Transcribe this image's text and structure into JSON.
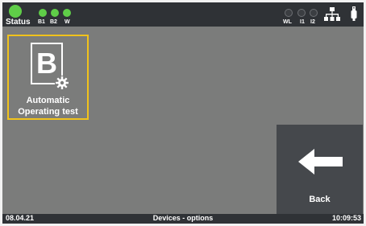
{
  "status_bar": {
    "status_label": "Status",
    "left_indicators": [
      {
        "label": "B1",
        "on": true
      },
      {
        "label": "B2",
        "on": true
      },
      {
        "label": "W",
        "on": true
      }
    ],
    "right_indicators": [
      {
        "label": "WL",
        "on": false
      },
      {
        "label": "I1",
        "on": false
      },
      {
        "label": "I2",
        "on": false
      }
    ],
    "icons": [
      "network-icon",
      "usb-icon"
    ],
    "led_on_color": "#5fcd48",
    "led_off_color": "#3b3e42"
  },
  "main": {
    "tile": {
      "icon": "b-document-gear-icon",
      "label_line1": "Automatic",
      "label_line2": "Operating test",
      "highlight_color": "#f0c21c"
    },
    "back_button": {
      "icon": "arrow-left-icon",
      "label": "Back"
    }
  },
  "footer": {
    "date": "08.04.21",
    "title": "Devices - options",
    "time": "10:09:53"
  }
}
